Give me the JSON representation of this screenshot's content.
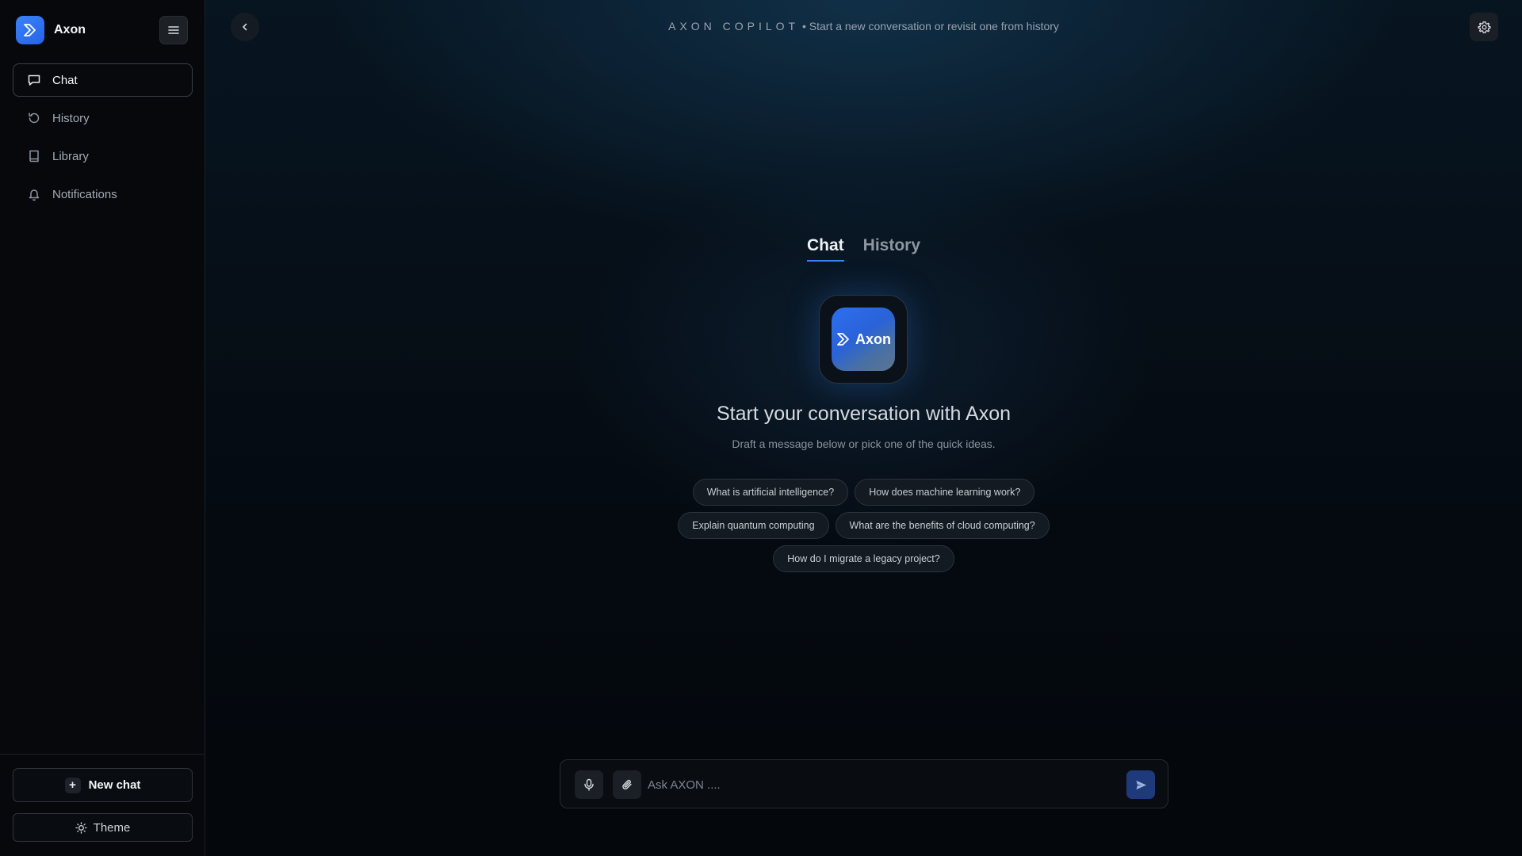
{
  "brand": {
    "name": "Axon",
    "accent": "#3b82f6"
  },
  "sidebar": {
    "items": [
      {
        "label": "Chat",
        "icon": "chat-bubble-icon",
        "active": true
      },
      {
        "label": "History",
        "icon": "history-icon",
        "active": false
      },
      {
        "label": "Library",
        "icon": "book-icon",
        "active": false
      },
      {
        "label": "Notifications",
        "icon": "bell-icon",
        "active": false
      }
    ],
    "new_chat_label": "New chat",
    "theme_label": "Theme"
  },
  "header": {
    "brand_caps": "AXON COPILOT",
    "subtitle": "• Start a new conversation or revisit one from history"
  },
  "tabs": [
    {
      "label": "Chat",
      "active": true
    },
    {
      "label": "History",
      "active": false
    }
  ],
  "hero": {
    "logo_text": "Axon",
    "title": "Start your conversation with Axon",
    "subtitle": "Draft a message below or pick one of the quick ideas."
  },
  "suggestions": [
    "What is artificial intelligence?",
    "How does machine learning work?",
    "Explain quantum computing",
    "What are the benefits of cloud computing?",
    "How do I migrate a legacy project?"
  ],
  "composer": {
    "placeholder": "Ask AXON ...."
  }
}
